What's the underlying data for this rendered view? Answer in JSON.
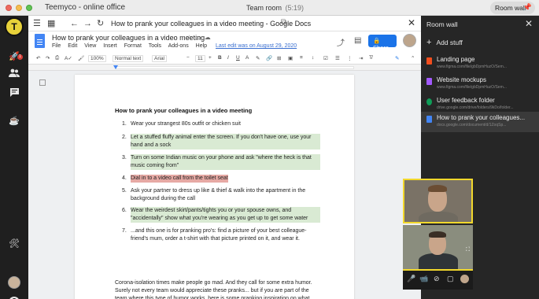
{
  "window": {
    "title": "Teemyco - online office",
    "room_title": "Team room",
    "room_time": "(5:19)",
    "room_wall_button": "Room wall"
  },
  "rail": {
    "logo_letter": "T",
    "notification_count": "1"
  },
  "browser": {
    "page_title": "How to prank your colleagues in a video meeting - Google Docs"
  },
  "docs": {
    "title": "How to prank your colleagues in a video meeting",
    "menu": [
      "File",
      "Edit",
      "View",
      "Insert",
      "Format",
      "Tools",
      "Add-ons",
      "Help"
    ],
    "last_edit": "Last edit was on August 29, 2020",
    "share_label": "Share",
    "toolbar": {
      "zoom": "100%",
      "style": "Normal text",
      "font": "Arial",
      "font_size": "11"
    }
  },
  "document": {
    "heading": "How to prank your colleagues in a video meeting",
    "items": [
      {
        "num": "1.",
        "text": "Wear your strangest 80s outfit or chicken suit",
        "highlight": "none"
      },
      {
        "num": "2.",
        "text": "Let a stuffed fluffy animal enter the screen. If you don't have one, use your hand and a sock",
        "highlight": "green"
      },
      {
        "num": "3.",
        "text": "Turn on some Indian music on your phone and ask \"where the heck is that music coming from\"",
        "highlight": "green"
      },
      {
        "num": "4.",
        "text": "Dial in to a video call from the toilet seat",
        "highlight": "red"
      },
      {
        "num": "5.",
        "text": "Ask your partner to dress up like & thief & walk into the apartment in the background during the call",
        "highlight": "none"
      },
      {
        "num": "6.",
        "text": "Wear the weirdest skirt/pants/tights you or your spouse owns, and \"accidentally\" show what you're wearing as you get up to get some water",
        "highlight": "green"
      },
      {
        "num": "7.",
        "text": "...and this one is for pranking pro's: find a picture of your best colleague-friend's mum, order a t-shirt with that picture printed on it, and wear it.",
        "highlight": "none"
      }
    ],
    "paragraph": "Corona-isolation times make people go mad. And they call for some extra humor. Surely not every team would appreciate these pranks... but if you are part of the team where this type of humor works, here is some pranking inspiration on what you can do to create somewhat"
  },
  "room_wall": {
    "header": "Room wall",
    "add_label": "Add stuff",
    "items": [
      {
        "name": "Landing page",
        "url": "www.figma.com/file/gbDpmHuzO/Sem...",
        "icon_color": "#f24e1e",
        "active": false
      },
      {
        "name": "Website mockups",
        "url": "www.figma.com/file/gbDpmHuzO/Sem...",
        "icon_color": "#a259ff",
        "active": false
      },
      {
        "name": "User feedback folder",
        "url": "drive.google.com/drive/folders/9kDo/folder...",
        "icon_color": "#0f9d58",
        "active": false
      },
      {
        "name": "How to prank your colleagues...",
        "url": "docs.google.com/document/d/1ZoqSp...",
        "icon_color": "#4285f4",
        "active": true
      }
    ]
  },
  "colors": {
    "accent_yellow": "#f2d82c",
    "share_blue": "#1a73e8",
    "highlight_green": "#d9ead3",
    "highlight_red": "#e6a9a4"
  }
}
